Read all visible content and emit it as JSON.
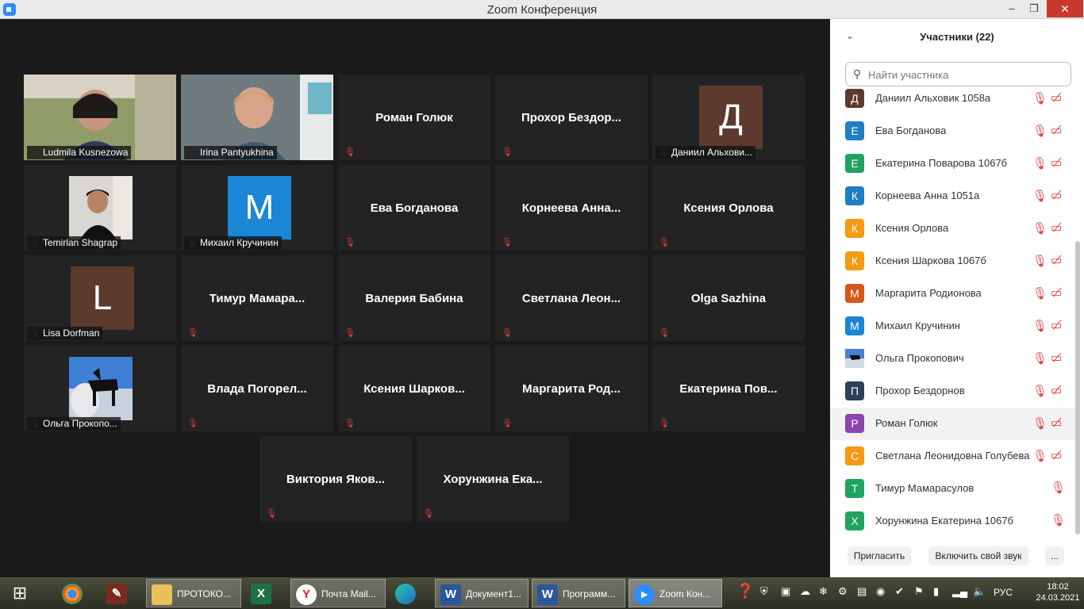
{
  "window": {
    "title": "Zoom Конференция",
    "minimize": "‒",
    "maximize": "❐",
    "close": "✕"
  },
  "tiles": [
    {
      "label": "Ludmila Kusnezowa"
    },
    {
      "label": "Irina Pantyukhina"
    },
    {
      "name": "Роман Голюк"
    },
    {
      "name": "Прохор  Бездор..."
    },
    {
      "label": "Даниил Альхови...",
      "initial": "Д",
      "color": "#5d3a2e"
    },
    {
      "label": "Temirlan Shagrap"
    },
    {
      "label": "Михаил Кручинин",
      "initial": "M",
      "color": "#1a86d4"
    },
    {
      "name": "Ева Богданова"
    },
    {
      "name": "Корнеева  Анна..."
    },
    {
      "name": "Ксения Орлова"
    },
    {
      "label": "Lisa Dorfman",
      "initial": "L",
      "color": "#5c3a2c"
    },
    {
      "name": "Тимур  Мамара..."
    },
    {
      "name": "Валерия Бабина"
    },
    {
      "name": "Светлана  Леон..."
    },
    {
      "name": "Olga Sazhina"
    },
    {
      "label": "Ольга Прокопо..."
    },
    {
      "name": "Влада  Погорел..."
    },
    {
      "name": "Ксения  Шарков..."
    },
    {
      "name": "Маргарита  Род..."
    },
    {
      "name": "Екатерина  Пов..."
    },
    {
      "name": "Виктория  Яков..."
    },
    {
      "name": "Хорунжина  Ека..."
    }
  ],
  "participants_panel": {
    "title": "Участники (22)",
    "search_placeholder": "Найти участника",
    "participants": [
      {
        "initial": "Д",
        "name": "Даниил Альховик 1058а",
        "color": "#5d3a2e"
      },
      {
        "initial": "Е",
        "name": "Ева Богданова",
        "color": "#1e7ec2"
      },
      {
        "initial": "Е",
        "name": "Екатерина Поварова 1067б",
        "color": "#1ea362"
      },
      {
        "initial": "К",
        "name": "Корнеева Анна 1051а",
        "color": "#1e7ec2"
      },
      {
        "initial": "К",
        "name": "Ксения Орлова",
        "color": "#f59a12"
      },
      {
        "initial": "К",
        "name": "Ксения Шаркова 1067б",
        "color": "#f59a12"
      },
      {
        "initial": "М",
        "name": "Маргарита Родионова",
        "color": "#d8561a"
      },
      {
        "initial": "М",
        "name": "Михаил Кручинин",
        "color": "#1a86d4"
      },
      {
        "initial": "",
        "name": "Ольга Прокопович",
        "color": "#8aa0c0"
      },
      {
        "initial": "П",
        "name": "Прохор Бездорнов",
        "color": "#2f3f5c"
      },
      {
        "initial": "Р",
        "name": "Роман Голюк",
        "color": "#8e44ad"
      },
      {
        "initial": "С",
        "name": "Светлана Леонидовна Голубева",
        "color": "#f59a12"
      },
      {
        "initial": "Т",
        "name": "Тимур Мамарасулов",
        "color": "#1ea362"
      },
      {
        "initial": "Х",
        "name": "Хорунжина Екатерина 1067б",
        "color": "#1ea362"
      }
    ],
    "invite": "Пригласить",
    "unmute": "Включить свой звук",
    "more": "..."
  },
  "taskbar": {
    "items": [
      {
        "label": "ПРОТОКО..."
      },
      {
        "label": "Почта Mail..."
      },
      {
        "label": "Документ1..."
      },
      {
        "label": "Программ..."
      },
      {
        "label": "Zoom Кон..."
      }
    ],
    "lang": "РУС",
    "time": "18:02",
    "date": "24.03.2021"
  }
}
